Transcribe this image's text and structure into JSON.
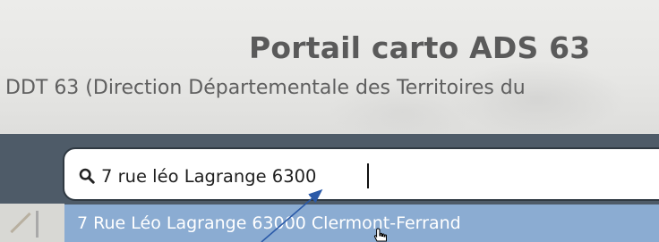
{
  "header": {
    "title": "Portail carto ADS 63",
    "subtitle": "DDT 63 (Direction Départementale des Territoires du"
  },
  "search": {
    "value": "7 rue léo Lagrange 6300",
    "icon": "search-icon"
  },
  "suggestions": [
    {
      "label": "7 Rue Léo Lagrange 63000 Clermont-Ferrand"
    }
  ],
  "colors": {
    "band": "#4e5b68",
    "suggestion_bg": "#8bacd2",
    "annotation_arrow": "#2b5aa8"
  }
}
